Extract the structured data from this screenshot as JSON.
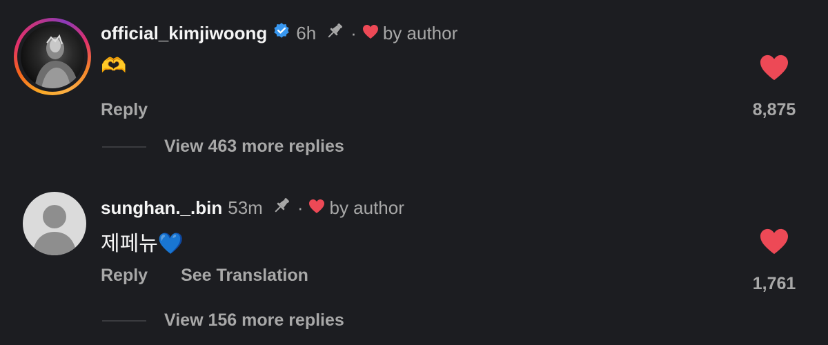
{
  "comments": [
    {
      "username": "official_kimjiwoong",
      "verified": true,
      "time": "6h",
      "pinned": true,
      "by_author": "by author",
      "body_emoji": "🫶",
      "actions": [
        "Reply"
      ],
      "like_count": "8,875",
      "view_replies": "View 463 more replies",
      "avatar": "profile-photo"
    },
    {
      "username": "sunghan._.bin",
      "verified": false,
      "time": "53m",
      "pinned": true,
      "by_author": "by author",
      "body_text": "제페뉴",
      "body_emoji": "💙",
      "actions": [
        "Reply",
        "See Translation"
      ],
      "like_count": "1,761",
      "view_replies": "View 156 more replies",
      "avatar": "default-avatar"
    }
  ],
  "colors": {
    "background": "#1c1d21",
    "heart": "#ed4956",
    "verified": "#3897f0",
    "muted": "#a8a8a8",
    "text": "#f5f5f5"
  },
  "icons": [
    "verified-badge-icon",
    "pin-icon",
    "heart-icon"
  ]
}
